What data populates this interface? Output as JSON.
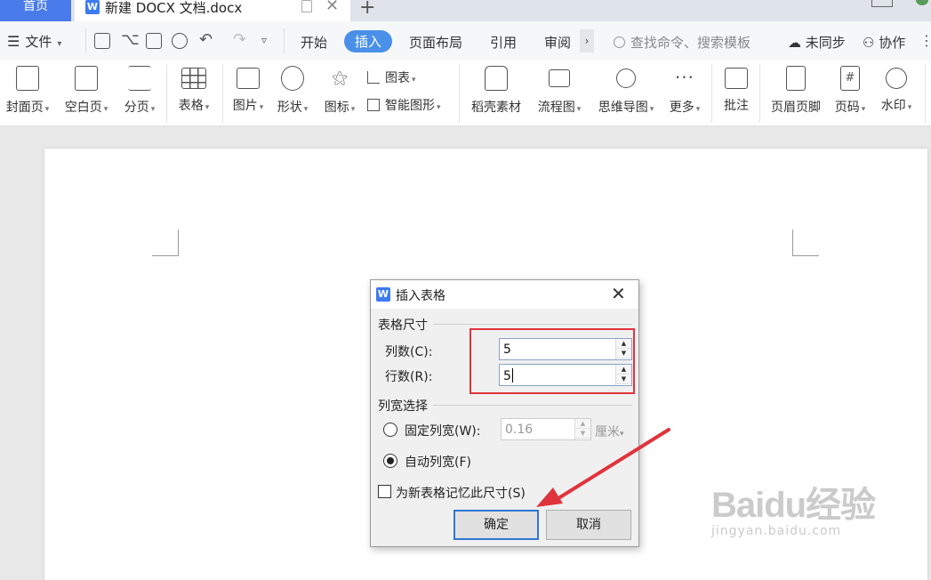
{
  "tabs": {
    "home": "首页",
    "doc_title": "新建 DOCX 文档.docx",
    "doc_logo": "W",
    "add": "+",
    "close": "✕"
  },
  "menu": {
    "file": "文件",
    "tabs": [
      "开始",
      "插入",
      "页面布局",
      "引用",
      "审阅"
    ],
    "active_tab": "插入",
    "more": "›",
    "search_placeholder": "查找命令、搜索模板",
    "sync": "未同步",
    "collab": "协作"
  },
  "ribbon": {
    "cover": "封面页",
    "blank": "空白页",
    "pagebreak": "分页",
    "table": "表格",
    "picture": "图片",
    "shape": "形状",
    "icon": "图标",
    "chart": "图表",
    "smartart": "智能图形",
    "material": "稻壳素材",
    "flowchart": "流程图",
    "mindmap": "思维导图",
    "more": "更多",
    "comment": "批注",
    "header_footer": "页眉页脚",
    "page_number": "页码",
    "watermark": "水印"
  },
  "dialog": {
    "logo": "W",
    "title": "插入表格",
    "close": "✕",
    "size_group": "表格尺寸",
    "columns_label": "列数(C):",
    "columns_value": "5",
    "rows_label": "行数(R):",
    "rows_value": "5",
    "width_group": "列宽选择",
    "fixed_width_label": "固定列宽(W):",
    "fixed_width_value": "0.16",
    "unit": "厘米",
    "auto_width_label": "自动列宽(F)",
    "remember_label": "为新表格记忆此尺寸(S)",
    "ok": "确定",
    "cancel": "取消",
    "selected_width_mode": "auto",
    "remember_checked": false
  },
  "watermark": {
    "brand": "Baidu经验",
    "url": "jingyan.baidu.com"
  },
  "colors": {
    "accent": "#4a90e8",
    "home_tab": "#4a7bea",
    "annotation": "#e0343c"
  }
}
